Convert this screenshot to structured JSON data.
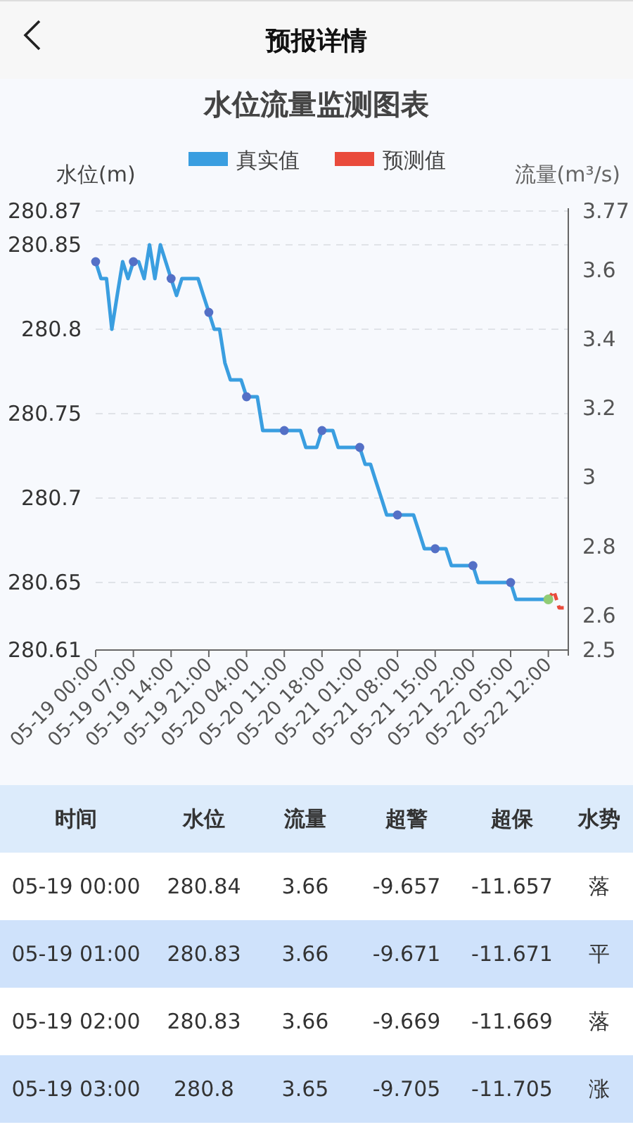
{
  "header": {
    "title": "预报详情"
  },
  "chart": {
    "title": "水位流量监测图表",
    "right_axis": {
      "title": "流量(m³/s)",
      "ticks": [
        "3.77",
        "3.6",
        "3.4",
        "3.2",
        "3",
        "2.8",
        "2.6",
        "2.5"
      ]
    },
    "chart_data": {
      "type": "line",
      "ylabel": "水位(m)",
      "grid": true,
      "legend": "top",
      "categories": [
        "05-19 00:00",
        null,
        null,
        null,
        null,
        null,
        null,
        "05-19 07:00",
        null,
        null,
        null,
        null,
        null,
        null,
        "05-19 14:00",
        null,
        null,
        null,
        null,
        null,
        null,
        "05-19 21:00",
        null,
        null,
        null,
        null,
        null,
        null,
        "05-20 04:00",
        null,
        null,
        null,
        null,
        null,
        null,
        "05-20 11:00",
        null,
        null,
        null,
        null,
        null,
        null,
        "05-20 18:00",
        null,
        null,
        null,
        null,
        null,
        null,
        "05-21 01:00",
        null,
        null,
        null,
        null,
        null,
        null,
        "05-21 08:00",
        null,
        null,
        null,
        null,
        null,
        null,
        "05-21 15:00",
        null,
        null,
        null,
        null,
        null,
        null,
        "05-21 22:00",
        null,
        null,
        null,
        null,
        null,
        null,
        "05-22 05:00",
        null,
        null,
        null,
        null,
        null,
        null,
        "05-22 12:00",
        null,
        null,
        null
      ],
      "series": [
        {
          "name": "真实值",
          "color": "#3a9ee0",
          "line_style": "solid",
          "values": [
            280.84,
            280.83,
            280.83,
            280.8,
            280.82,
            280.84,
            280.83,
            280.84,
            280.84,
            280.83,
            280.85,
            280.83,
            280.85,
            280.84,
            280.83,
            280.82,
            280.83,
            280.83,
            280.83,
            280.83,
            280.82,
            280.81,
            280.8,
            280.8,
            280.78,
            280.77,
            280.77,
            280.77,
            280.76,
            280.76,
            280.76,
            280.74,
            280.74,
            280.74,
            280.74,
            280.74,
            280.74,
            280.74,
            280.74,
            280.73,
            280.73,
            280.73,
            280.74,
            280.74,
            280.74,
            280.73,
            280.73,
            280.73,
            280.73,
            280.73,
            280.72,
            280.72,
            280.71,
            280.7,
            280.69,
            280.69,
            280.69,
            280.69,
            280.69,
            280.69,
            280.68,
            280.67,
            280.67,
            280.67,
            280.67,
            280.67,
            280.66,
            280.66,
            280.66,
            280.66,
            280.66,
            280.65,
            280.65,
            280.65,
            280.65,
            280.65,
            280.65,
            280.65,
            280.64,
            280.64,
            280.64,
            280.64,
            280.64,
            280.64,
            280.64,
            null,
            null,
            null
          ]
        },
        {
          "name": "预测值",
          "color": "#e94b3c",
          "line_style": "dashed",
          "values": [
            null,
            null,
            null,
            null,
            null,
            null,
            null,
            null,
            null,
            null,
            null,
            null,
            null,
            null,
            null,
            null,
            null,
            null,
            null,
            null,
            null,
            null,
            null,
            null,
            null,
            null,
            null,
            null,
            null,
            null,
            null,
            null,
            null,
            null,
            null,
            null,
            null,
            null,
            null,
            null,
            null,
            null,
            null,
            null,
            null,
            null,
            null,
            null,
            null,
            null,
            null,
            null,
            null,
            null,
            null,
            null,
            null,
            null,
            null,
            null,
            null,
            null,
            null,
            null,
            null,
            null,
            null,
            null,
            null,
            null,
            null,
            null,
            null,
            null,
            null,
            null,
            null,
            null,
            null,
            null,
            null,
            null,
            null,
            null,
            280.64,
            280.645,
            280.635,
            280.635
          ]
        }
      ],
      "ylim": [
        280.61,
        280.87
      ],
      "yticks": [
        280.61,
        280.65,
        280.7,
        280.75,
        280.8,
        280.85,
        280.87
      ]
    }
  },
  "table": {
    "columns": [
      "时间",
      "水位",
      "流量",
      "超警",
      "超保",
      "水势"
    ],
    "rows": [
      [
        "05-19 00:00",
        "280.84",
        "3.66",
        "-9.657",
        "-11.657",
        "落"
      ],
      [
        "05-19 01:00",
        "280.83",
        "3.66",
        "-9.671",
        "-11.671",
        "平"
      ],
      [
        "05-19 02:00",
        "280.83",
        "3.66",
        "-9.669",
        "-11.669",
        "落"
      ],
      [
        "05-19 03:00",
        "280.8",
        "3.65",
        "-9.705",
        "-11.705",
        "涨"
      ]
    ]
  }
}
